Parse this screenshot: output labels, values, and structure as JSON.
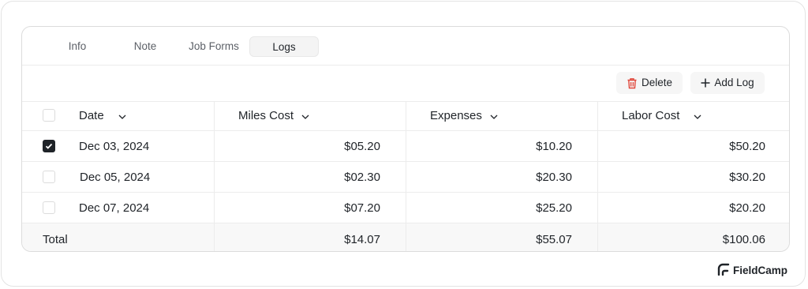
{
  "tabs": [
    "Info",
    "Note",
    "Job Forms",
    "Logs"
  ],
  "toolbar": {
    "delete_label": "Delete",
    "add_label": "Add Log"
  },
  "columns": [
    "Date",
    "Miles Cost",
    "Expenses",
    "Labor Cost"
  ],
  "rows": [
    {
      "checked": true,
      "date": "Dec 03, 2024",
      "miles": "$05.20",
      "expenses": "$10.20",
      "labor": "$50.20"
    },
    {
      "checked": false,
      "date": "Dec 05, 2024",
      "miles": "$02.30",
      "expenses": "$20.30",
      "labor": "$30.20"
    },
    {
      "checked": false,
      "date": "Dec 07, 2024",
      "miles": "$07.20",
      "expenses": "$25.20",
      "labor": "$20.20"
    }
  ],
  "total": {
    "label": "Total",
    "miles": "$14.07",
    "expenses": "$55.07",
    "labor": "$100.06"
  },
  "brand": "FieldCamp",
  "colors": {
    "delete_icon": "#e0463a",
    "text": "#1f2328",
    "checkbox_on": "#1f2328"
  }
}
